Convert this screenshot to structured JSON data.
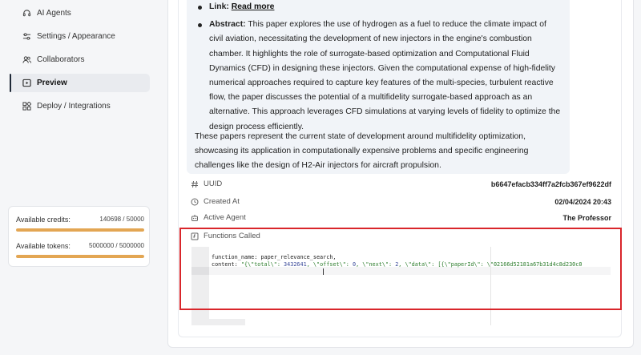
{
  "sidebar": {
    "items": [
      {
        "label": "AI Agents",
        "icon": "headset-icon",
        "active": false
      },
      {
        "label": "Settings / Appearance",
        "icon": "sliders-icon",
        "active": false
      },
      {
        "label": "Collaborators",
        "icon": "users-icon",
        "active": false
      },
      {
        "label": "Preview",
        "icon": "play-icon",
        "active": true
      },
      {
        "label": "Deploy / Integrations",
        "icon": "grid-icon",
        "active": false
      }
    ],
    "credits": {
      "credits_label": "Available credits:",
      "credits_value": "140698 / 50000",
      "credits_fraction": 1.0,
      "tokens_label": "Available tokens:",
      "tokens_value": "5000000 / 5000000",
      "tokens_fraction": 1.0
    }
  },
  "message": {
    "link_label": "Link:",
    "link_text": "Read more",
    "abstract_label": "Abstract:",
    "abstract_text": "This paper explores the use of hydrogen as a fuel to reduce the climate impact of civil aviation, necessitating the development of new injectors in the engine's combustion chamber. It highlights the role of surrogate-based optimization and Computational Fluid Dynamics (CFD) in designing these injectors. Given the computational expense of high-fidelity numerical approaches required to capture key features of the multi-species, turbulent reactive flow, the paper discusses the potential of a multifidelity surrogate-based approach as an alternative. This approach leverages CFD simulations at varying levels of fidelity to optimize the design process efficiently.",
    "summary": "These papers represent the current state of development around multifidelity optimization, showcasing its application in computationally expensive problems and specific engineering challenges like the design of H2-Air injectors for aircraft propulsion."
  },
  "meta": {
    "uuid_label": "UUID",
    "uuid_value": "b6647efacb334ff7a2fcb367ef9622df",
    "created_label": "Created At",
    "created_value": "02/04/2024 20:43",
    "agent_label": "Active Agent",
    "agent_value": "The Professor",
    "functions_label": "Functions Called"
  },
  "code": {
    "line1": "function_name: paper_relevance_search,",
    "line2_key": "content: ",
    "line2_str_a": "\"{\\\"total\\\": ",
    "line2_num_a": "3432641",
    "line2_str_b": ", \\\"offset\\\": ",
    "line2_num_b": "0",
    "line2_str_c": ", \\\"next\\\": ",
    "line2_num_c": "2",
    "line2_str_d": ", \\\"data\\\": [{\\\"paperId\\\": \\\"02166d52181a67b31d4c8d230c0"
  },
  "colors": {
    "accent": "#e3a653",
    "highlight_frame": "#d9262b"
  }
}
